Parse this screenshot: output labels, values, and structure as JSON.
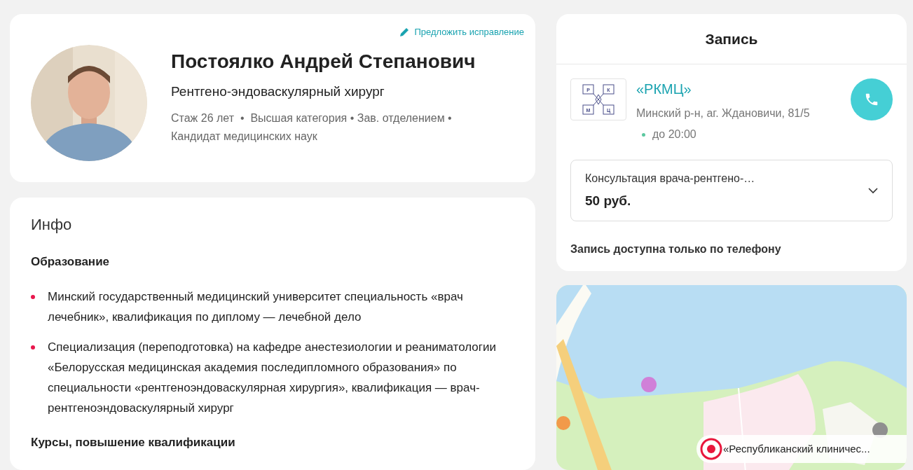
{
  "profile": {
    "suggest_link": "Предложить исправление",
    "name": "Постоялко Андрей Степанович",
    "specialty": "Рентгено-эндоваскулярный хирург",
    "facts": "Стаж 26 лет  •  Высшая категория • Зав. отделением • Кандидат медицинских наук"
  },
  "info": {
    "title": "Инфо",
    "sections": [
      {
        "heading": "Образование",
        "items": [
          "Минский государственный медицинский университет специальность «врач лечебник», квалификация по диплому — лечебной дело",
          "Специализация (переподготовка) на кафедре анестезиологии и реаниматологии «Белорусская медицинская академия последипломного образования» по специальности «рентгеноэндоваскулярная хирургия», квалификация — врач-рентгеноэндоваскулярный хирург"
        ]
      },
      {
        "heading": "Курсы, повышение квалификации"
      }
    ]
  },
  "booking": {
    "title": "Запись",
    "clinic": {
      "logo_letters": [
        "Р",
        "К",
        "М",
        "Ц"
      ],
      "name": "«РКМЦ»",
      "address": "Минский р-н, аг. Ждановичи, 81/5",
      "hours": "до 20:00"
    },
    "service": {
      "label": "Консультация врача-рентгено-…",
      "price": "50 руб."
    },
    "note": "Запись доступна только по телефону"
  },
  "map": {
    "pin_label": "«Республиканский клиничес..."
  }
}
